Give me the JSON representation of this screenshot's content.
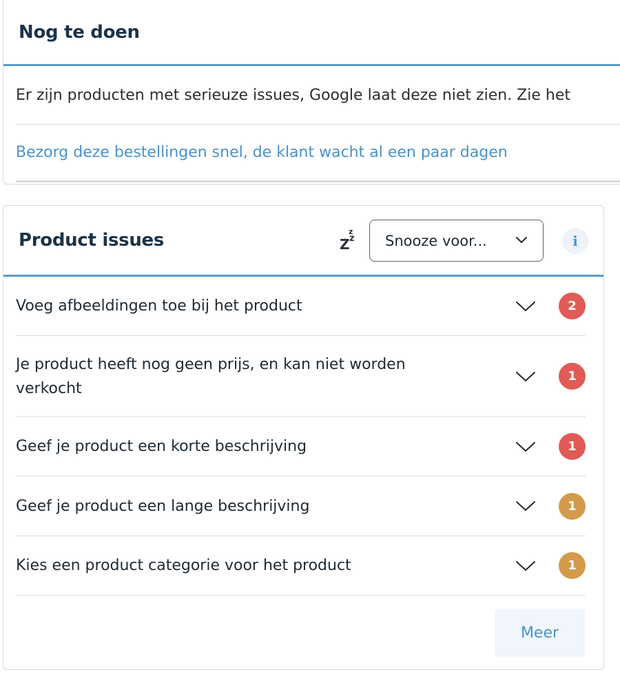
{
  "todo": {
    "title": "Nog te doen",
    "items": [
      "Er zijn producten met serieuze issues, Google laat deze niet zien. Zie het",
      "Bezorg deze bestellingen snel, de klant wacht al een paar dagen"
    ]
  },
  "issues": {
    "title": "Product issues",
    "snooze_icon": "zzz-icon",
    "snooze_label": "Snooze voor...",
    "info_icon": "info-icon",
    "info_glyph": "i",
    "rows": [
      {
        "text": "Voeg afbeeldingen toe bij het product",
        "count": "2",
        "severity": "red"
      },
      {
        "text": "Je product heeft nog geen prijs, en kan niet worden verkocht",
        "count": "1",
        "severity": "red"
      },
      {
        "text": "Geef je product een korte beschrijving",
        "count": "1",
        "severity": "red"
      },
      {
        "text": "Geef je product een lange beschrijving",
        "count": "1",
        "severity": "orange"
      },
      {
        "text": "Kies een product categorie voor het product",
        "count": "1",
        "severity": "orange"
      }
    ],
    "more_label": "Meer"
  },
  "colors": {
    "accent": "#5a9acb",
    "link": "#4a93c8",
    "red": "#e05b57",
    "orange": "#d49a4b"
  }
}
